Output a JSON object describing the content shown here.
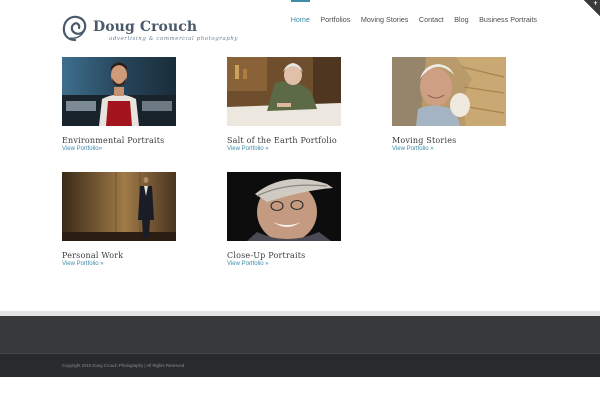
{
  "brand": {
    "name": "Doug Crouch",
    "tagline": "advertising & commercial photography",
    "accent_color": "#3e8ca8",
    "logo_icon": "swirl-logo-icon"
  },
  "nav": {
    "items": [
      {
        "label": "Home",
        "active": true
      },
      {
        "label": "Portfolios",
        "active": false
      },
      {
        "label": "Moving Stories",
        "active": false
      },
      {
        "label": "Contact",
        "active": false
      },
      {
        "label": "Blog",
        "active": false
      },
      {
        "label": "Business Portraits",
        "active": false
      }
    ]
  },
  "corner_toggle": {
    "glyph": "+"
  },
  "portfolios": [
    {
      "title": "Environmental Portraits",
      "link": "View Portfolio»"
    },
    {
      "title": "Salt of the Earth Portfolio",
      "link": "View Portfolio »"
    },
    {
      "title": "Moving Stories",
      "link": "View Portfolio »"
    },
    {
      "title": "Personal Work",
      "link": "View Portfolio »"
    },
    {
      "title": "Close-Up Portraits",
      "link": "View Portfolio »"
    }
  ],
  "footer": {
    "copyright": "Copyright 2015 Doug Crouch Photography | All Rights Reserved"
  }
}
